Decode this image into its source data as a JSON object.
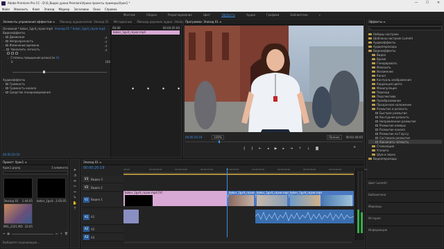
{
  "window": {
    "title": "Adobe Premiere Pro CC - D:\\0_Видео уроки Premiere\\Уроки проекты примеры\\Урок1 *",
    "controls": [
      "—",
      "☐",
      "✕"
    ]
  },
  "menu": [
    "Файл",
    "Изменить",
    "Клип",
    "Эпизод",
    "Маркер",
    "Заголовок",
    "Окно",
    "Справка"
  ],
  "workspaces": {
    "items": [
      "Монтаж",
      "Сборка",
      "Редактирование",
      "Цвет",
      "Эффекты",
      "Аудио",
      "Графика",
      "Библиотеки"
    ],
    "active": "Эффекты",
    "overflow": "»"
  },
  "effect_controls": {
    "tabs": [
      "Элементы управления эффектом ≡",
      "Микшер аудиоклипов: Эпизод 01",
      "Метаданные",
      "Микшер дорожек аудио: Эпизод 01"
    ],
    "source": "Основной * bokor_1gvit_rajvar.mp4",
    "seq_source": "Эпизод 01 * bokor_1gvit_rajvar.mp4",
    "time_marks": [
      "00:00",
      "00:00:05:00"
    ],
    "clip_label": "bokor_1gvit_rajvar.mp4",
    "video_header": "Видеоэффекты",
    "video_rows": [
      {
        "name": "Движение",
        "fx": true
      },
      {
        "name": "Непрозрачность",
        "fx": true
      },
      {
        "name": "Изменение времени",
        "fx": true
      },
      {
        "name": "Увеличить четкость",
        "fx": true
      }
    ],
    "sharpen_label": "Степень повышения резкости",
    "sharpen_value": "33",
    "slider_min": "0",
    "slider_max": "100",
    "audio_header": "Аудиоэффекты",
    "audio_rows": [
      "Громкость",
      "Громкость канала",
      "Средство панорамирования"
    ],
    "timecode": "00:00:20:19"
  },
  "program": {
    "title": "Программа: Эпизод 01 ≡",
    "timecode_in": "00:00:20:19",
    "zoom": "100%",
    "quality": "Полное",
    "timecode_out": "00:01:44:05"
  },
  "effects": {
    "tab": "Эффекты ≡",
    "search_placeholder": "",
    "tree": [
      {
        "label": "Наборы настроек",
        "level": 0,
        "type": "folder"
      },
      {
        "label": "Шаблоны настроек Lumetri",
        "level": 0,
        "type": "folder"
      },
      {
        "label": "Аудиоэффекты",
        "level": 0,
        "type": "folder"
      },
      {
        "label": "Аудиопереходы",
        "level": 0,
        "type": "folder"
      },
      {
        "label": "Видеоэффекты",
        "level": 0,
        "type": "folder"
      },
      {
        "label": "Видео",
        "level": 1,
        "type": "folder"
      },
      {
        "label": "Время",
        "level": 1,
        "type": "folder"
      },
      {
        "label": "Генерировать",
        "level": 1,
        "type": "folder"
      },
      {
        "label": "Изменить",
        "level": 1,
        "type": "folder"
      },
      {
        "label": "Искажение",
        "level": 1,
        "type": "folder"
      },
      {
        "label": "Канал",
        "level": 1,
        "type": "folder"
      },
      {
        "label": "Контроль изображения",
        "level": 1,
        "type": "folder"
      },
      {
        "label": "Коррекция цвета",
        "level": 1,
        "type": "folder"
      },
      {
        "label": "Манипуляция",
        "level": 1,
        "type": "folder"
      },
      {
        "label": "Переход",
        "level": 1,
        "type": "folder"
      },
      {
        "label": "Перспектива",
        "level": 1,
        "type": "folder"
      },
      {
        "label": "Преобразование",
        "level": 1,
        "type": "folder"
      },
      {
        "label": "Прозрачное наложение",
        "level": 1,
        "type": "folder"
      },
      {
        "label": "Размытие и резкость",
        "level": 1,
        "type": "folder"
      },
      {
        "label": "Быстрое размытие",
        "level": 2,
        "type": "fx"
      },
      {
        "label": "Контурная резкость",
        "level": 2,
        "type": "fx"
      },
      {
        "label": "Направленное размытие",
        "level": 2,
        "type": "fx"
      },
      {
        "label": "Размытие камеры",
        "level": 2,
        "type": "fx"
      },
      {
        "label": "Размытие канала",
        "level": 2,
        "type": "fx"
      },
      {
        "label": "Размытие по Гауссу",
        "level": 2,
        "type": "fx"
      },
      {
        "label": "Составное размытие",
        "level": 2,
        "type": "fx"
      },
      {
        "label": "Увеличить четкость",
        "level": 2,
        "type": "fx",
        "selected": true
      },
      {
        "label": "Стилизация",
        "level": 1,
        "type": "folder"
      },
      {
        "label": "Утилита",
        "level": 1,
        "type": "folder"
      },
      {
        "label": "Шум и зерно",
        "level": 1,
        "type": "folder"
      },
      {
        "label": "Видеопереходы",
        "level": 0,
        "type": "folder"
      }
    ],
    "collapsed_panels": [
      "Цвет Lumetri",
      "Библиотеки",
      "Маркеры",
      "История",
      "Информация"
    ]
  },
  "project": {
    "title": "Проект: Урок1 ≡",
    "file": "Урок1.prproj",
    "count": "3 элемента",
    "items": [
      {
        "name": "Эпизод 01",
        "dur": "1:44:05"
      },
      {
        "name": "bokor_1gvit...",
        "dur": "1:05:05"
      },
      {
        "name": "IMG_2321.MO",
        "dur": "33:05"
      }
    ],
    "status": "Выберите подходящую..."
  },
  "timeline": {
    "title": "Эпизод 01 ≡",
    "timecode": "00:00:20:19",
    "ruler": [
      "00:00",
      "00:00:05:00",
      "00:00:10:00",
      "00:00:15:00",
      "00:00:20:00",
      "00:00:25:00",
      "00:00:30:00",
      "00:00:35:00",
      "00:00:40:00",
      "00:00:45:00"
    ],
    "video_tracks": [
      "V3",
      "V2",
      "V1"
    ],
    "video_names": [
      "Видео 3",
      "Видео 2",
      "Видео 1"
    ],
    "audio_tracks": [
      "A1",
      "A2",
      "A3"
    ],
    "audio_names": [
      "A1",
      "A2",
      "A3"
    ],
    "clip1": "bokor_1gvit_rajvar.mp4 [V]",
    "clip2": "bokor_1gvit_rajvar.mp4 [V]",
    "clip3": "bokor_1gvit_rajvar.mp4 [V]",
    "clip4": "bokor_1gvit_rajvar.mp4 [V]",
    "db_labels": [
      "0",
      "-12",
      "-24",
      "-36",
      "-48",
      "dB"
    ]
  },
  "colors": {
    "accent": "#3b8ee8",
    "clip_pink": "#d9a9d5",
    "clip_blue": "#4a78c2",
    "audio": "#3a6fb0"
  }
}
